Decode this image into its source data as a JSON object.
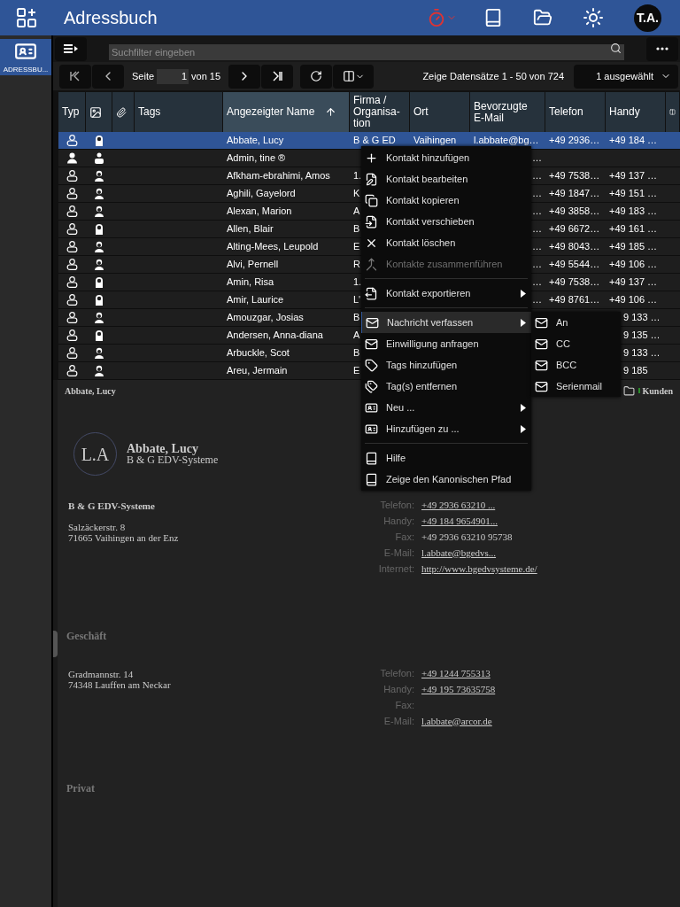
{
  "app": {
    "title": "Adressbuch",
    "user_initials": "T.A."
  },
  "sidebar": {
    "items": [
      {
        "label": "ADRESSBU...",
        "selected": true
      }
    ]
  },
  "search": {
    "placeholder": "Suchfilter eingeben"
  },
  "pager": {
    "page_label": "Seite",
    "page": "1",
    "of": "von 15",
    "info": "Zeige Datensätze 1 - 50 von 724",
    "selection": "1 ausgewählt"
  },
  "table": {
    "columns": [
      {
        "kind": "text",
        "label": "Typ",
        "selected": false
      },
      {
        "kind": "image",
        "selected": false
      },
      {
        "kind": "attachment",
        "selected": false
      },
      {
        "kind": "text",
        "label": "Tags",
        "selected": false
      },
      {
        "kind": "text",
        "label": "Angezeigter Name",
        "selected": true,
        "sorted": true
      },
      {
        "kind": "text",
        "label": "Firma / Organisa-tion",
        "selected": false
      },
      {
        "kind": "text",
        "label": "Ort",
        "selected": false
      },
      {
        "kind": "text",
        "label": "Bevorzugte E-Mail",
        "selected": false
      },
      {
        "kind": "text",
        "label": "Telefon",
        "selected": false
      },
      {
        "kind": "text",
        "label": "Handy",
        "selected": false
      },
      {
        "kind": "columns",
        "selected": false
      }
    ],
    "rows": [
      {
        "kind": "contact",
        "avatar": {
          "kind": "female"
        },
        "name": "Abbate, Lucy",
        "firma": "B & G ED",
        "ort": "Vaihingen",
        "email": "l.abbate@bg…",
        "telefon": "+49 2936…",
        "handy": "+49 184 …",
        "selected": true
      },
      {
        "kind": "user",
        "avatar": {
          "kind": "user"
        },
        "name": "Admin, tine ®",
        "email": "…",
        "selected": false
      },
      {
        "kind": "contact",
        "avatar": {
          "kind": "male"
        },
        "name": "Afkham-ebrahimi, Amos",
        "firma": "1.",
        "email": "…",
        "telefon": "+49 7538…",
        "handy": "+49 137 …",
        "selected": false
      },
      {
        "kind": "contact",
        "avatar": {
          "kind": "male"
        },
        "name": "Aghili, Gayelord",
        "firma": "K",
        "email": "…",
        "telefon": "+49 1847…",
        "handy": "+49 151 …",
        "selected": false
      },
      {
        "kind": "contact",
        "avatar": {
          "kind": "male"
        },
        "name": "Alexan, Marion",
        "firma": "A",
        "email": "…",
        "telefon": "+49 3858…",
        "handy": "+49 183 …",
        "selected": false
      },
      {
        "kind": "contact",
        "avatar": {
          "kind": "female"
        },
        "name": "Allen, Blair",
        "firma": "B",
        "email": "…",
        "telefon": "+49 6672…",
        "handy": "+49 161 …",
        "selected": false
      },
      {
        "kind": "contact",
        "avatar": {
          "kind": "male"
        },
        "name": "Alting-Mees, Leupold",
        "firma": "E",
        "email": "…",
        "telefon": "+49 8043…",
        "handy": "+49 185 …",
        "selected": false
      },
      {
        "kind": "contact",
        "avatar": {
          "kind": "male"
        },
        "name": "Alvi, Pernell",
        "firma": "R",
        "email": "…",
        "telefon": "+49 5544…",
        "handy": "+49 106 …",
        "selected": false
      },
      {
        "kind": "contact",
        "avatar": {
          "kind": "female"
        },
        "name": "Amin, Risa",
        "firma": "1.",
        "email": "…",
        "telefon": "+49 7538…",
        "handy": "+49 137 …",
        "selected": false
      },
      {
        "kind": "contact",
        "avatar": {
          "kind": "female"
        },
        "name": "Amir, Laurice",
        "firma": "L'",
        "email": "…",
        "telefon": "+49 8761…",
        "handy": "+49 106 …",
        "selected": false
      },
      {
        "kind": "contact",
        "avatar": {
          "kind": "male"
        },
        "name": "Amouzgar, Josias",
        "firma": "B",
        "handy_tail": "9 133 …",
        "selected": false
      },
      {
        "kind": "contact",
        "avatar": {
          "kind": "female"
        },
        "name": "Andersen, Anna-diana",
        "firma": "A",
        "handy_tail": "9 135 …",
        "selected": false
      },
      {
        "kind": "contact",
        "avatar": {
          "kind": "male"
        },
        "name": "Arbuckle, Scot",
        "firma": "B",
        "handy_tail": "9 133 …",
        "selected": false
      },
      {
        "kind": "contact",
        "avatar": {
          "kind": "male"
        },
        "name": "Areu, Jermain",
        "firma": "E",
        "handy_tail": "9 185",
        "selected": false
      }
    ]
  },
  "context_menu": {
    "items": [
      {
        "kind": "item",
        "label": "Kontakt hinzufügen",
        "disabled": false,
        "submenu": false,
        "selected": false
      },
      {
        "kind": "item",
        "label": "Kontakt bearbeiten",
        "disabled": false,
        "submenu": false,
        "selected": false
      },
      {
        "kind": "item",
        "label": "Kontakt kopieren",
        "disabled": false,
        "submenu": false,
        "selected": false
      },
      {
        "kind": "item",
        "label": "Kontakt verschieben",
        "disabled": false,
        "submenu": false,
        "selected": false
      },
      {
        "kind": "item",
        "label": "Kontakt löschen",
        "disabled": false,
        "submenu": false,
        "selected": false
      },
      {
        "kind": "item",
        "label": "Kontakte zusammenführen",
        "disabled": true,
        "submenu": false,
        "selected": false
      },
      {
        "kind": "separator"
      },
      {
        "kind": "item",
        "label": "Kontakt exportieren",
        "disabled": false,
        "submenu": true,
        "selected": false
      },
      {
        "kind": "separator"
      },
      {
        "kind": "item",
        "label": "Nachricht verfassen",
        "disabled": false,
        "submenu": true,
        "selected": true
      },
      {
        "kind": "item",
        "label": "Einwilligung anfragen",
        "disabled": false,
        "submenu": false,
        "selected": false
      },
      {
        "kind": "item",
        "label": "Tags hinzufügen",
        "disabled": false,
        "submenu": false,
        "selected": false
      },
      {
        "kind": "item",
        "label": "Tag(s) entfernen",
        "disabled": false,
        "submenu": false,
        "selected": false
      },
      {
        "kind": "item",
        "label": "Neu ...",
        "disabled": false,
        "submenu": true,
        "selected": false
      },
      {
        "kind": "item",
        "label": "Hinzufügen zu ...",
        "disabled": false,
        "submenu": true,
        "selected": false
      },
      {
        "kind": "separator"
      },
      {
        "kind": "item",
        "label": "Hilfe",
        "disabled": false,
        "submenu": false,
        "selected": false
      },
      {
        "kind": "item",
        "label": "Zeige den Kanonischen Pfad",
        "disabled": false,
        "submenu": false,
        "selected": false
      }
    ],
    "submenu": [
      "An",
      "CC",
      "BCC",
      "Serienmail"
    ]
  },
  "detail": {
    "title": "Abbate, Lucy",
    "folder": "Kunden",
    "initials": "L.A",
    "name": "Abbate, Lucy",
    "company": "B & G EDV-Systeme",
    "sections": [
      {
        "org": "B & G EDV-Systeme",
        "address": [
          "Salzäckerstr. 8",
          "71665 Vaihingen an der Enz"
        ],
        "fields": [
          {
            "label": "Telefon:",
            "value": "+49 2936 63210 ...",
            "link": true
          },
          {
            "label": "Handy:",
            "value": "+49 184 9654901...",
            "link": true
          },
          {
            "label": "Fax:",
            "value": "+49 2936 63210 95738",
            "link": false
          },
          {
            "label": "E-Mail:",
            "value": "l.abbate@bgedvs...",
            "link": true
          },
          {
            "label": "Internet:",
            "value": "http://www.bgedvsysteme.de/",
            "link": true
          }
        ]
      },
      {
        "heading": "Geschäft",
        "address": [
          "Gradmannstr. 14",
          "74348 Lauffen am Neckar"
        ],
        "fields": [
          {
            "label": "Telefon:",
            "value": "+49 1244 755313",
            "link": true
          },
          {
            "label": "Handy:",
            "value": "+49 195 73635758",
            "link": true
          },
          {
            "label": "Fax:"
          },
          {
            "label": "E-Mail:",
            "value": "l.abbate@arcor.de",
            "link": true
          }
        ]
      },
      {
        "heading": "Privat"
      }
    ]
  }
}
